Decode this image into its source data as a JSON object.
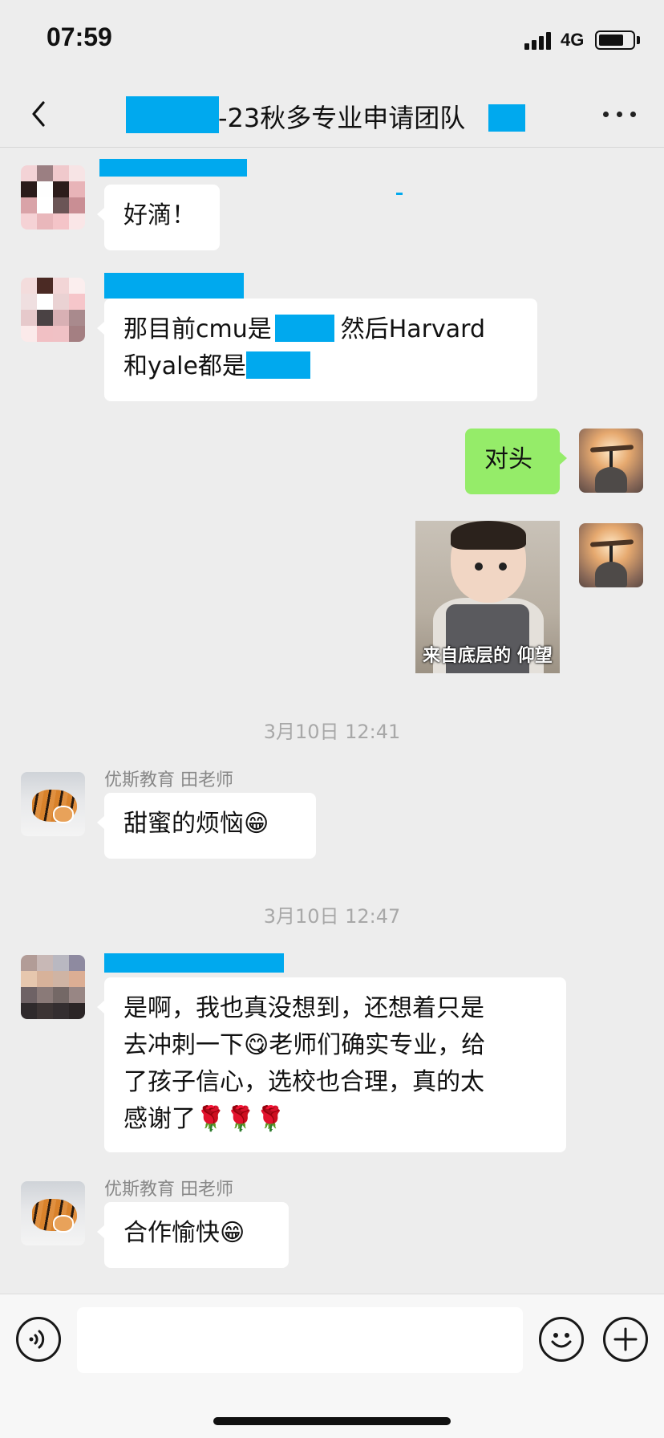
{
  "status_bar": {
    "time": "07:59",
    "network": "4G"
  },
  "header": {
    "title_suffix": "-23秋多专业申请团队",
    "back_icon": "chevron-left-icon",
    "more_icon": "more-dots-icon"
  },
  "messages": [
    {
      "id": "m1",
      "side": "left",
      "text": "好滴！"
    },
    {
      "id": "m2",
      "side": "left",
      "line1_a": "那目前cmu是",
      "line1_b": "然后Harvard",
      "line2_a": "和yale都是"
    },
    {
      "id": "m3",
      "side": "right",
      "text": "对头"
    },
    {
      "id": "m4",
      "side": "right",
      "sticker_caption": "来自底层的 仰望"
    },
    {
      "id": "ts1",
      "timestamp": "3月10日 12:41"
    },
    {
      "id": "m5",
      "side": "left",
      "sender": "优斯教育 田老师",
      "text": "甜蜜的烦恼",
      "emoji": "😁"
    },
    {
      "id": "ts2",
      "timestamp": "3月10日 12:47"
    },
    {
      "id": "m6",
      "side": "left",
      "line1": "是啊，我也真没想到，还想着只是",
      "line2_a": "去冲刺一下",
      "line2_emoji": "😋",
      "line2_b": "老师们确实专业，给",
      "line3": "了孩子信心，选校也合理，真的太",
      "line4": "感谢了",
      "line4_emoji": "🌹🌹🌹"
    },
    {
      "id": "m7",
      "side": "left",
      "sender": "优斯教育 田老师",
      "text": "合作愉快",
      "emoji": "😁"
    }
  ],
  "input_bar": {
    "voice_icon": "voice-icon",
    "emoji_icon": "emoji-smile-icon",
    "plus_icon": "plus-icon"
  },
  "colors": {
    "background": "#ededed",
    "self_bubble": "#95ec69",
    "redaction": "#00a9ee"
  }
}
